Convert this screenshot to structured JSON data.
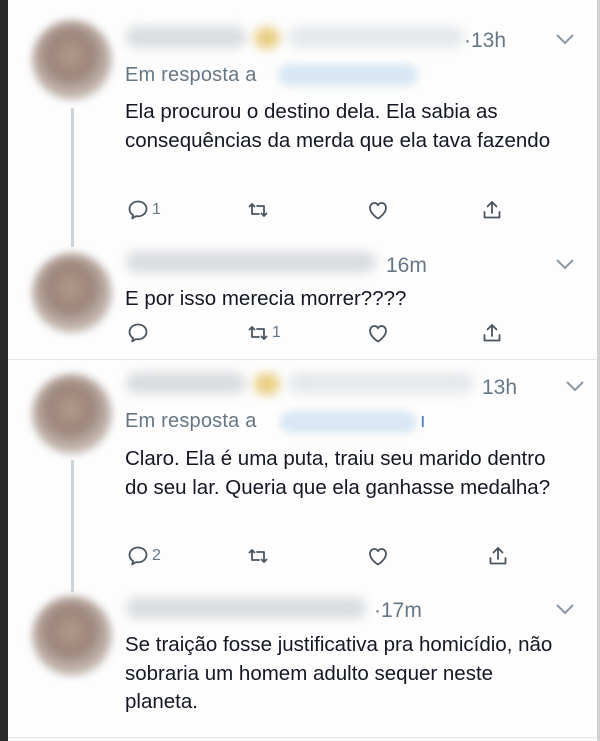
{
  "tweets": [
    {
      "time": "·13h",
      "reply_label": "Em resposta a",
      "text": "Ela procurou o destino dela. Ela sabia as consequências da merda que ela tava fazendo",
      "reply_count": "1",
      "retweet_count": "",
      "like_count": ""
    },
    {
      "time": "16m",
      "reply_label": "",
      "text": "E por isso merecia morrer????",
      "reply_count": "",
      "retweet_count": "1",
      "like_count": ""
    },
    {
      "time": "13h",
      "reply_label": "Em resposta a",
      "text": "Claro. Ela é uma puta, traiu seu marido dentro do seu lar. Queria que ela ganhasse medalha?",
      "reply_count": "2",
      "retweet_count": "",
      "like_count": ""
    },
    {
      "time": "·17m",
      "reply_label": "",
      "text": "Se traição fosse justificativa pra homicídio, não sobraria um homem adulto sequer neste planeta.",
      "reply_count": "",
      "retweet_count": "",
      "like_count": ""
    }
  ],
  "handle_tail": "ı",
  "icons": {
    "reply": "reply-icon",
    "retweet": "retweet-icon",
    "like": "heart-icon",
    "share": "share-icon",
    "menu": "chevron-down-icon"
  },
  "colors": {
    "text": "#141823",
    "secondary": "#657786",
    "divider": "#e3e6e8",
    "thread_line": "#cdd4d9"
  }
}
